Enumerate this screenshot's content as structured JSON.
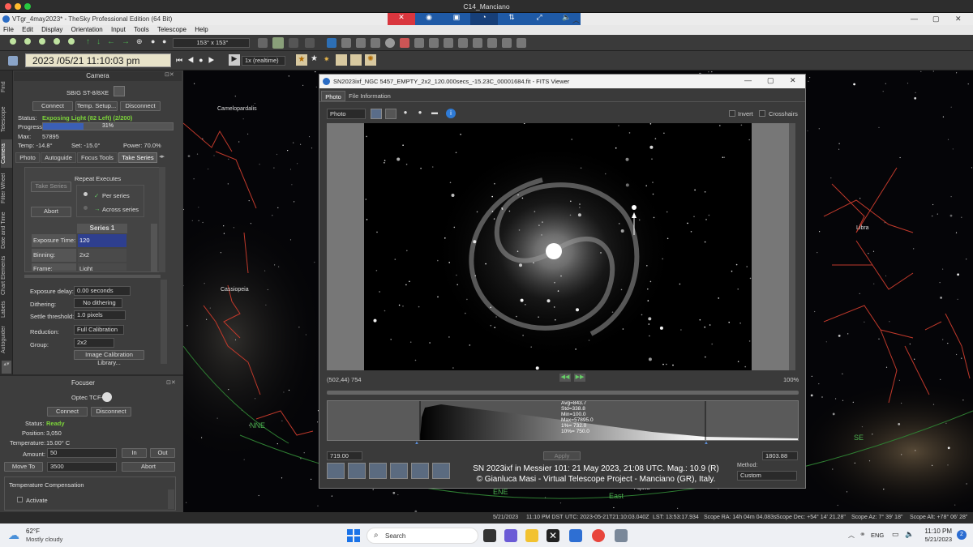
{
  "mac": {
    "title": "C14_Manciano"
  },
  "window": {
    "title": "VTgr_4may2023* - TheSky Professional Edition (64 Bit)"
  },
  "menu": [
    "File",
    "Edit",
    "Display",
    "Orientation",
    "Input",
    "Tools",
    "Telescope",
    "Help"
  ],
  "toolbar": {
    "fov": "153° x 153°"
  },
  "time": {
    "datetime": "2023 /05/21  11:10:03 pm",
    "rate": "1x (realtime)"
  },
  "tabs": [
    "Find",
    "Telescope",
    "Camera",
    "Filter Wheel",
    "Date and Time",
    "Chart Elements",
    "Labels",
    "Autoguider"
  ],
  "camera": {
    "header": "Camera",
    "model": "SBIG ST-8/8XE",
    "connect": "Connect",
    "temp_setup": "Temp. Setup...",
    "disconnect": "Disconnect",
    "status_label": "Status:",
    "status": "Exposing Light (82 Left) (2/200)",
    "progress_label": "Progress:",
    "progress": "31%",
    "progress_value": 31,
    "max_label": "Max:",
    "max": "57895",
    "temp_label": "Temp: -14.8°",
    "set_label": "Set: -15.0°",
    "power_label": "Power: 70.0%",
    "subtabs": [
      "Photo",
      "Autoguide",
      "Focus Tools",
      "Take Series"
    ],
    "repeat_executes": "Repeat Executes",
    "take_series": "Take Series",
    "per_series": "Per series",
    "across_series": "Across series",
    "abort": "Abort",
    "series_header": "Series 1",
    "rows": [
      {
        "label": "Exposure Time:",
        "value": "120"
      },
      {
        "label": "Binning:",
        "value": "2x2"
      },
      {
        "label": "Frame:",
        "value": "Light"
      }
    ],
    "exposure_delay_label": "Exposure delay:",
    "exposure_delay": "0.00 seconds",
    "dithering_label": "Dithering:",
    "dithering": "No dithering",
    "settle_label": "Settle threshold:",
    "settle": "1.0 pixels",
    "reduction_label": "Reduction:",
    "reduction": "Full Calibration",
    "group_label": "Group:",
    "group": "2x2",
    "calib_lib": "Image Calibration Library..."
  },
  "focuser": {
    "header": "Focuser",
    "model": "Optec TCF-S",
    "connect": "Connect",
    "disconnect": "Disconnect",
    "status_label": "Status:",
    "status": "Ready",
    "position_label": "Position:",
    "position": "3,050",
    "temperature_label": "Temperature:",
    "temperature": "15.00° C",
    "amount_label": "Amount:",
    "amount": "50",
    "in": "In",
    "out": "Out",
    "move_to": "Move To",
    "move_to_value": "3500",
    "abort": "Abort",
    "temp_comp": "Temperature Compensation",
    "activate": "Activate"
  },
  "sky": {
    "labels": [
      "Camelopardalis",
      "Cassiopeia",
      "Libra",
      "NNE",
      "ENE",
      "East",
      "SE",
      "Aquila"
    ]
  },
  "fits": {
    "title": "SN2023ixf_NGC 5457_EMPTY_2x2_120.000secs_-15.23C_00001684.fit - FITS Viewer",
    "tabs": [
      "Photo",
      "File Information"
    ],
    "mode": "Photo",
    "invert": "Invert",
    "crosshairs": "Crosshairs",
    "coords": "(502,44) 754",
    "zoom": "100%",
    "stats": [
      "Avg=843.7",
      "Std=338.8",
      "Min=100.0",
      "Max=57895.0",
      "1%=  732.0",
      "10%=  750.0"
    ],
    "low": "719.00",
    "high": "1803.88",
    "apply": "Apply",
    "method_label": "Method:",
    "method": "Custom",
    "caption1": "SN 2023ixf in Messier 101: 21 May 2023, 21:08 UTC. Mag.: 10.9 (R)",
    "caption2": "© Gianluca Masi - Virtual Telescope Project - Manciano (GR), Italy."
  },
  "status": {
    "date": "5/21/2023",
    "local": "11:10 PM DST",
    "utc": "UTC: 2023-05-21T21:10:03.040Z",
    "lst": "LST: 13:53:17.934",
    "ra": "Scope RA: 14h 04m 04.083s",
    "dec": "Scope Dec: +54° 14' 21.28\"",
    "az": "Scope Az: 7° 39' 18\"",
    "alt": "Scope Alt: +78° 06' 28\""
  },
  "taskbar": {
    "temp": "62°F",
    "weather": "Mostly cloudy",
    "search": "Search",
    "lang": "ENG",
    "time": "11:10 PM",
    "date": "5/21/2023"
  }
}
